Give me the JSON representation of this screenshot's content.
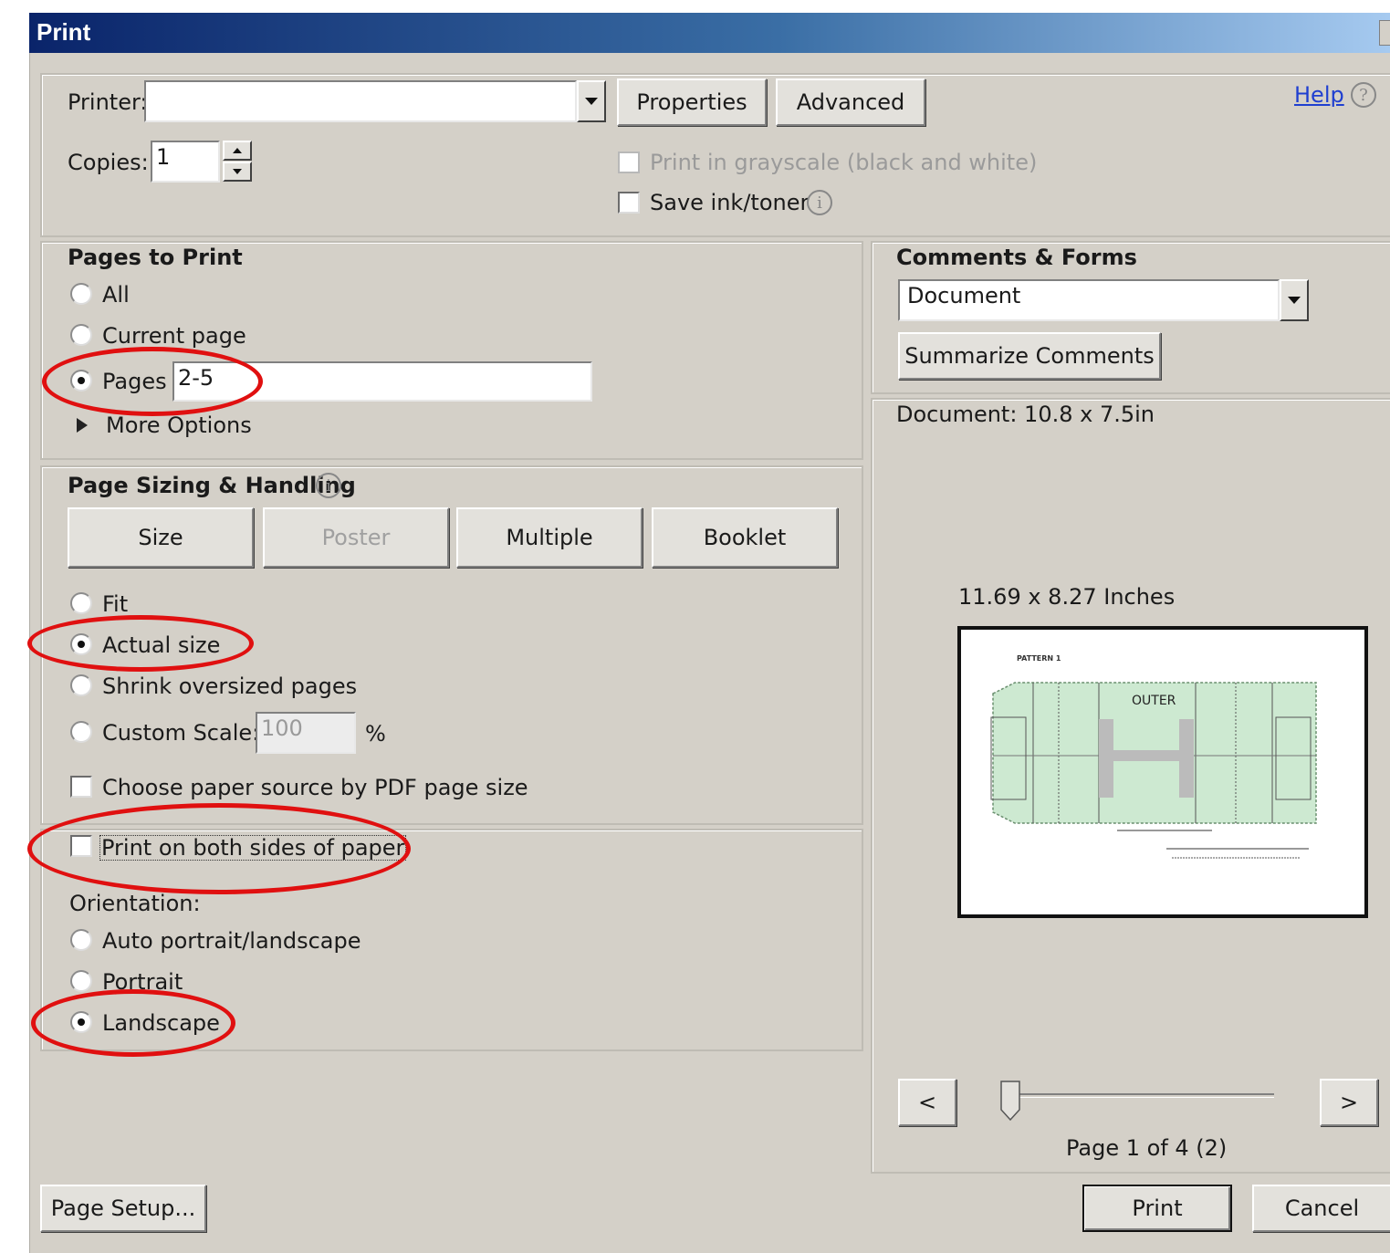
{
  "window": {
    "title": "Print"
  },
  "printer": {
    "label": "Printer:",
    "value": "",
    "properties_button": "Properties",
    "advanced_button": "Advanced",
    "help_link": "Help"
  },
  "copies": {
    "label": "Copies:",
    "value": "1"
  },
  "options": {
    "grayscale": "Print in grayscale (black and white)",
    "save_ink": "Save ink/toner"
  },
  "pages_to_print": {
    "heading": "Pages to Print",
    "all": "All",
    "current": "Current page",
    "pages": "Pages",
    "pages_value": "2-5",
    "more_options": "More Options"
  },
  "sizing": {
    "heading": "Page Sizing & Handling",
    "tabs": [
      "Size",
      "Poster",
      "Multiple",
      "Booklet"
    ],
    "fit": "Fit",
    "actual": "Actual size",
    "shrink": "Shrink oversized pages",
    "custom": "Custom Scale:",
    "custom_value": "100",
    "percent": "%",
    "paper_source": "Choose paper source by PDF page size"
  },
  "duplex": {
    "label": "Print on both sides of paper"
  },
  "orientation": {
    "heading": "Orientation:",
    "auto": "Auto portrait/landscape",
    "portrait": "Portrait",
    "landscape": "Landscape"
  },
  "comments": {
    "heading": "Comments & Forms",
    "select_value": "Document",
    "summarize_button": "Summarize Comments"
  },
  "preview": {
    "document_size": "Document: 10.8 x 7.5in",
    "paper_size": "11.69 x 8.27 Inches",
    "page_label": "PATTERN 1",
    "outer_label": "OUTER",
    "prev_button": "<",
    "next_button": ">",
    "page_status": "Page 1 of 4 (2)",
    "slider_value": 0.0
  },
  "footer": {
    "page_setup": "Page Setup...",
    "print": "Print",
    "cancel": "Cancel"
  },
  "colors": {
    "dialog_bg": "#d4d0c8",
    "title_start": "#0a246a",
    "title_end": "#a6caf0",
    "highlight": "#e01010",
    "pattern_fill": "#cde9d1"
  }
}
